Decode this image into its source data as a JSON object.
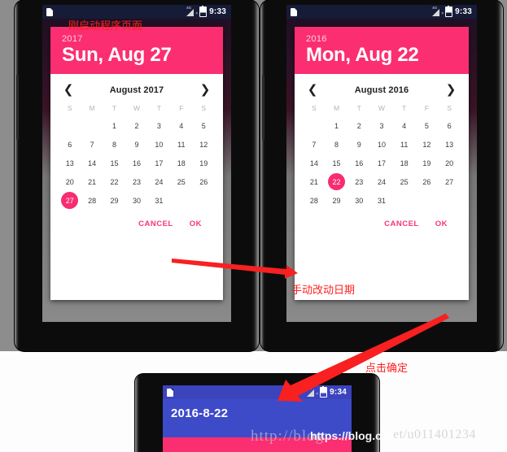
{
  "annotations": {
    "launch_note": "刚启动程序页面",
    "manual_change_note": "手动改动日期",
    "confirm_note": "点击确定"
  },
  "watermarks": {
    "serif_blog": "http://blog",
    "bold_blog": "https://blog.csdn.n",
    "faint_tail": "et/u011401234"
  },
  "phone_left": {
    "status_bar": {
      "sim_icon": "sim-card-icon",
      "signal_icon": "signal-4g-no-service-icon",
      "signal_label": "4G",
      "battery_icon": "battery-icon",
      "clock": "9:33"
    },
    "dialog": {
      "year": "2017",
      "headline": "Sun, Aug 27",
      "prev_icon": "chevron-left-icon",
      "next_icon": "chevron-right-icon",
      "month_title": "August 2017",
      "weekdays": [
        "S",
        "M",
        "T",
        "W",
        "T",
        "F",
        "S"
      ],
      "weeks": [
        [
          "",
          "",
          "1",
          "2",
          "3",
          "4",
          "5"
        ],
        [
          "6",
          "7",
          "8",
          "9",
          "10",
          "11",
          "12"
        ],
        [
          "13",
          "14",
          "15",
          "16",
          "17",
          "18",
          "19"
        ],
        [
          "20",
          "21",
          "22",
          "23",
          "24",
          "25",
          "26"
        ],
        [
          "27",
          "28",
          "29",
          "30",
          "31",
          "",
          ""
        ]
      ],
      "selected_day": "27",
      "cancel_label": "CANCEL",
      "ok_label": "OK"
    }
  },
  "phone_right": {
    "status_bar": {
      "sim_icon": "sim-card-icon",
      "signal_icon": "signal-4g-no-service-icon",
      "signal_label": "4G",
      "battery_icon": "battery-icon",
      "clock": "9:33"
    },
    "dialog": {
      "year": "2016",
      "headline": "Mon, Aug 22",
      "prev_icon": "chevron-left-icon",
      "next_icon": "chevron-right-icon",
      "month_title": "August 2016",
      "weekdays": [
        "S",
        "M",
        "T",
        "W",
        "T",
        "F",
        "S"
      ],
      "weeks": [
        [
          "",
          "1",
          "2",
          "3",
          "4",
          "5",
          "6"
        ],
        [
          "7",
          "8",
          "9",
          "10",
          "11",
          "12",
          "13"
        ],
        [
          "14",
          "15",
          "16",
          "17",
          "18",
          "19",
          "20"
        ],
        [
          "21",
          "22",
          "23",
          "24",
          "25",
          "26",
          "27"
        ],
        [
          "28",
          "29",
          "30",
          "31",
          "",
          "",
          ""
        ]
      ],
      "selected_day": "22",
      "cancel_label": "CANCEL",
      "ok_label": "OK"
    }
  },
  "phone_bottom": {
    "status_bar": {
      "sim_icon": "sim-card-icon",
      "signal_icon": "signal-4g-no-service-icon",
      "signal_label": "4G",
      "battery_icon": "battery-icon",
      "clock": "9:34"
    },
    "app_bar_title": "2016-8-22"
  },
  "colors": {
    "accent_pink": "#fb2e71",
    "status_navy": "#161b38",
    "app_indigo": "#3e4bc8",
    "annotation_red": "#ff1f1f"
  }
}
